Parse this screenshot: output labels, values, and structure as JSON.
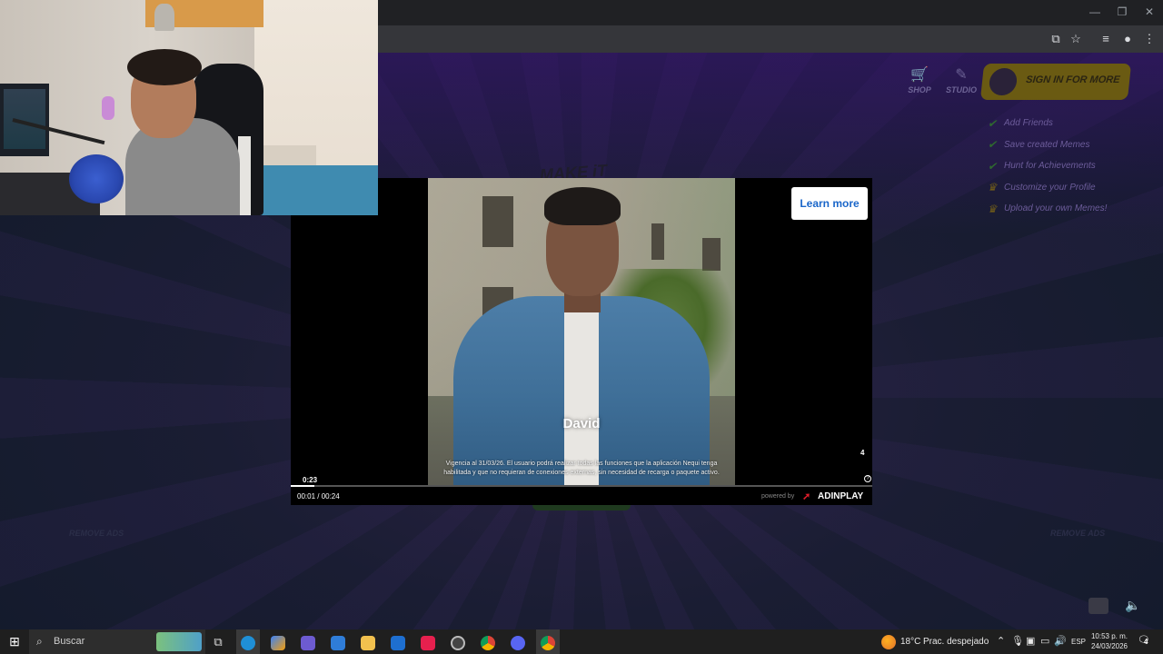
{
  "page": {
    "shop_label": "SHOP",
    "studio_label": "STUDIO",
    "signin_label": "SIGN IN FOR MORE",
    "perks": [
      {
        "label": "Add Friends",
        "icon": "check-icon"
      },
      {
        "label": "Save created Memes",
        "icon": "check-icon"
      },
      {
        "label": "Hunt for Achievements",
        "icon": "check-icon"
      },
      {
        "label": "Customize your Profile",
        "icon": "crown-icon"
      },
      {
        "label": "Upload your own Memes!",
        "icon": "crown-icon"
      }
    ],
    "make_it": "MAKE iT",
    "remove_ads_left": "REMOVE ADS",
    "remove_ads_right": "REMOVE ADS"
  },
  "ad": {
    "learn_more": "Learn more",
    "name_caption": "David",
    "disclaimer": "Vigencia al 31/03/26. El usuario podrá realizar todas las funciones que la aplicación Nequi tenga habilitada y que no requieran de conexiones externas, sin necesidad de recarga o paquete activo.",
    "countdown": "0:23",
    "skip_number": "4",
    "help_symbol": "?",
    "time_display": "00:01 / 00:24",
    "progress_fraction": 0.04,
    "powered_by": "powered by",
    "brand": "ADINPLAY"
  },
  "taskbar": {
    "search_placeholder": "Buscar",
    "weather_temp": "18°C",
    "weather_desc": "Prac. despejado",
    "language": "ESP",
    "time": "10:53 p. m.",
    "date": "24/03/2026",
    "notification_count": "4"
  },
  "colors": {
    "learn_more_text": "#1a66c9",
    "brand_accent": "#e11d2a",
    "signin_bg": "#6a5a12"
  }
}
